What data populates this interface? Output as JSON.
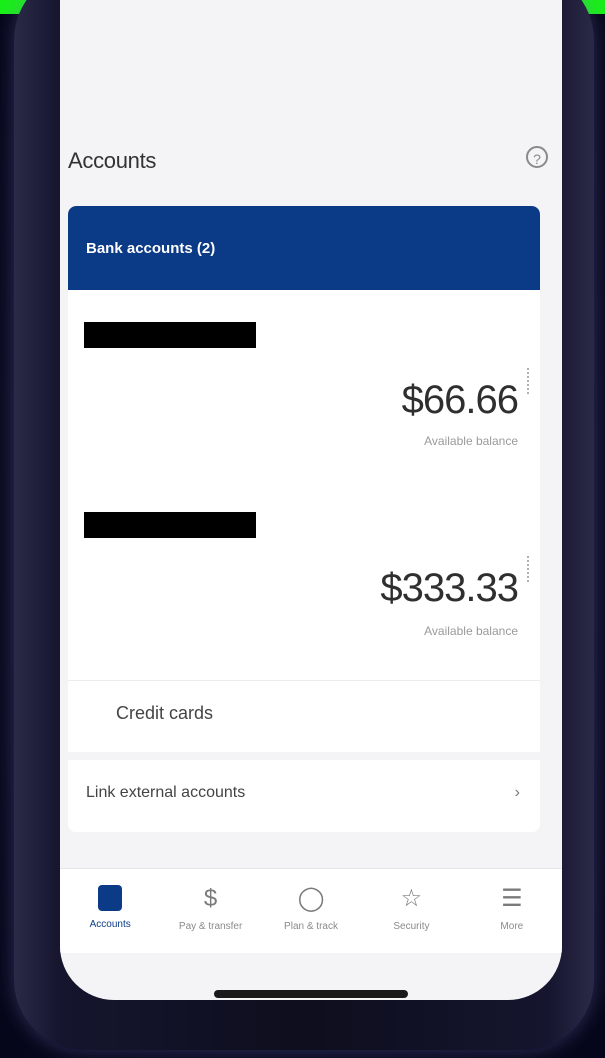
{
  "header": {
    "title": "Accounts",
    "help_icon": "?"
  },
  "bank_accounts": {
    "label": "Bank accounts (2)",
    "accounts": [
      {
        "name": "",
        "balance": "$66.66",
        "caption": "Available balance"
      },
      {
        "name": "",
        "balance": "$333.33",
        "caption": "Available balance"
      }
    ]
  },
  "credit_cards": {
    "label": "Credit cards"
  },
  "external": {
    "label": "Link external accounts",
    "chevron": "›"
  },
  "nav": {
    "items": [
      {
        "label": "Accounts",
        "icon": "accounts-icon",
        "glyph": ""
      },
      {
        "label": "Pay & transfer",
        "icon": "dollar-circle-icon",
        "glyph": "$"
      },
      {
        "label": "Plan & track",
        "icon": "tag-icon",
        "glyph": "◯"
      },
      {
        "label": "Security",
        "icon": "star-icon",
        "glyph": "☆"
      },
      {
        "label": "More",
        "icon": "menu-icon",
        "glyph": "☰"
      }
    ]
  },
  "colors": {
    "accent": "#0b3a86",
    "top_strip": "#19ee19"
  }
}
